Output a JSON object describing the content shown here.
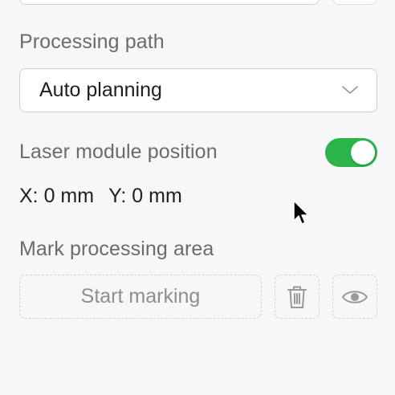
{
  "processing_path": {
    "label": "Processing path",
    "selected": "Auto planning"
  },
  "laser_module": {
    "label": "Laser module position",
    "toggle_on": true,
    "x_text": "X: 0 mm",
    "y_text": "Y: 0 mm"
  },
  "mark_area": {
    "label": "Mark processing area",
    "start_button": "Start marking"
  },
  "colors": {
    "toggle_on": "#2bb44a",
    "label_gray": "#6b6b6b",
    "disabled_text": "#8e8e8e"
  },
  "icons": [
    "chevron-down-icon",
    "trash-icon",
    "eye-icon",
    "mouse-pointer-icon"
  ]
}
